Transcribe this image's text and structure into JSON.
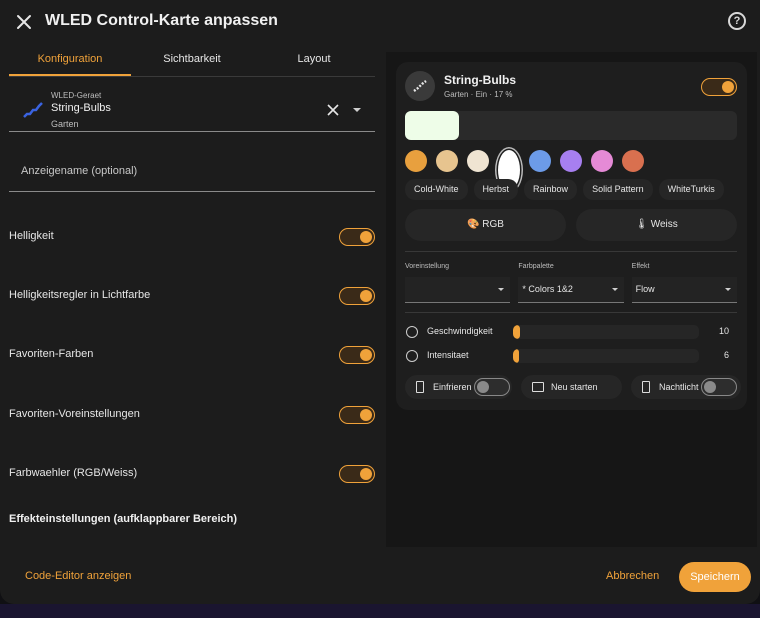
{
  "dialog": {
    "title": "WLED Control-Karte anpassen",
    "help_icon": "help-circle-icon",
    "tabs": [
      {
        "label": "Konfiguration",
        "active": true
      },
      {
        "label": "Sichtbarkeit",
        "active": false
      },
      {
        "label": "Layout",
        "active": false
      }
    ]
  },
  "entity_picker": {
    "label": "WLED-Geraet",
    "name": "String-Bulbs",
    "area": "Garten"
  },
  "display_name": {
    "placeholder": "Anzeigename (optional)"
  },
  "options": [
    {
      "label": "Helligkeit",
      "enabled": true
    },
    {
      "label": "Helligkeitsregler in Lichtfarbe",
      "enabled": true
    },
    {
      "label": "Favoriten-Farben",
      "enabled": true
    },
    {
      "label": "Favoriten-Voreinstellungen",
      "enabled": true
    },
    {
      "label": "Farbwaehler (RGB/Weiss)",
      "enabled": true
    }
  ],
  "section_title": "Effekteinstellungen (aufklappbarer Bereich)",
  "footer": {
    "code_editor": "Code-Editor anzeigen",
    "cancel": "Abbrechen",
    "save": "Speichern"
  },
  "preview": {
    "name": "String-Bulbs",
    "state": "Garten · Ein · 17 %",
    "on": true,
    "current_color": "#eefde8",
    "colors": [
      "#e8a03e",
      "#e7c48f",
      "#efe4d2",
      "#ffffff",
      "#6c9be8",
      "#a77ff0",
      "#e58ad6",
      "#d9704f"
    ],
    "presets": [
      "Cold-White",
      "Herbst",
      "Rainbow",
      "Solid Pattern",
      "WhiteTurkis"
    ],
    "modes": [
      {
        "label": "RGB",
        "icon": "palette-icon"
      },
      {
        "label": "Weiss",
        "icon": "thermometer-icon"
      }
    ],
    "selects": [
      {
        "label": "Voreinstellung",
        "value": ""
      },
      {
        "label": "Farbpalette",
        "value": "* Colors 1&2"
      },
      {
        "label": "Effekt",
        "value": "Flow"
      }
    ],
    "sliders": [
      {
        "label": "Geschwindigkeit",
        "value": "10",
        "fraction": 0.04
      },
      {
        "label": "Intensitaet",
        "value": "6",
        "fraction": 0.025
      }
    ],
    "switches": [
      {
        "label": "Einfrieren",
        "on": false
      },
      {
        "label": "Neu starten",
        "on": null
      },
      {
        "label": "Nachtlicht",
        "on": false
      }
    ]
  },
  "accent_color": "#f0a23a"
}
